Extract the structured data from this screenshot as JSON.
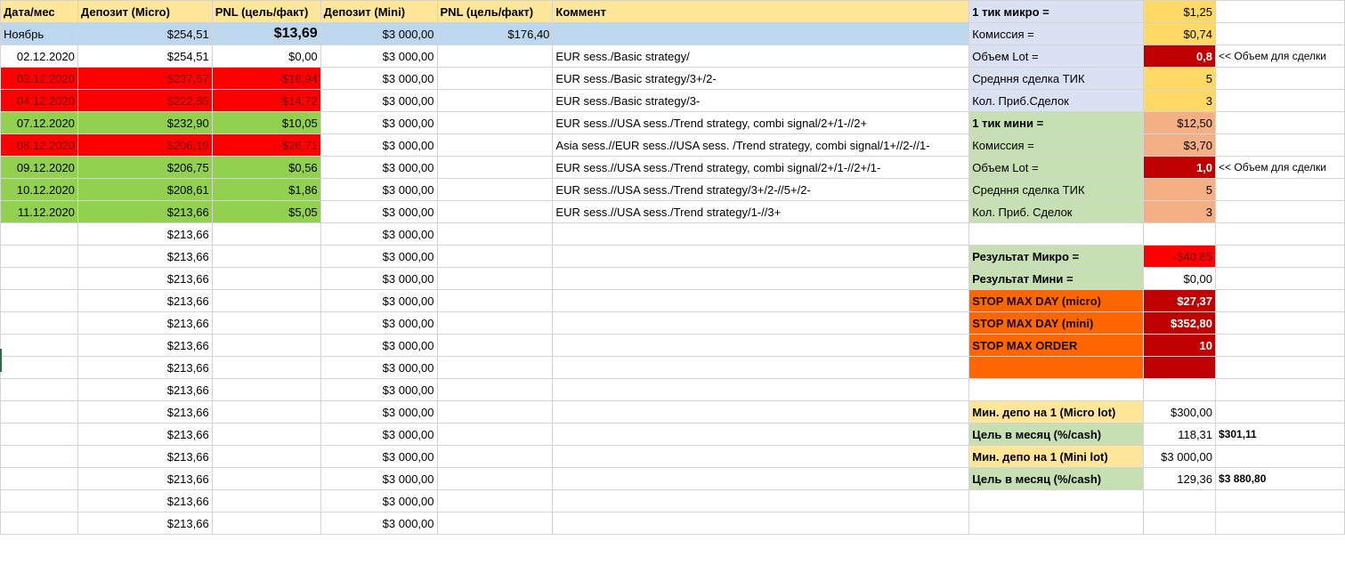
{
  "headers": [
    "Дата/мес",
    "Депозит (Micro)",
    "PNL (цель/факт)",
    "Депозит (Mini)",
    "PNL (цель/факт)",
    "Коммент"
  ],
  "november": {
    "label": "Ноябрь",
    "deposit_micro": "$254,51",
    "pnl_micro": "$13,69",
    "deposit_mini": "$3 000,00",
    "pnl_mini": "$176,40"
  },
  "days": [
    {
      "date": "02.12.2020",
      "deposit_micro": "$254,51",
      "pnl": "$0,00",
      "deposit_mini": "$3 000,00",
      "comment": "EUR sess./Basic strategy/"
    },
    {
      "date": "03.12.2020",
      "deposit_micro": "$237,57",
      "pnl": "-$16,94",
      "deposit_mini": "$3 000,00",
      "comment": "EUR sess./Basic strategy/3+/2-"
    },
    {
      "date": "04.12.2020",
      "deposit_micro": "$222,85",
      "pnl": "-$14,72",
      "deposit_mini": "$3 000,00",
      "comment": "EUR sess./Basic strategy/3-"
    },
    {
      "date": "07.12.2020",
      "deposit_micro": "$232,90",
      "pnl": "$10,05",
      "deposit_mini": "$3 000,00",
      "comment": "EUR sess.//USA sess./Trend strategy, combi signal/2+/1-//2+"
    },
    {
      "date": "08.12.2020",
      "deposit_micro": "$206,19",
      "pnl": "-$26,71",
      "deposit_mini": "$3 000,00",
      "comment": "Asia sess.//EUR sess.//USA sess. /Trend strategy, combi signal/1+//2-//1-"
    },
    {
      "date": "09.12.2020",
      "deposit_micro": "$206,75",
      "pnl": "$0,56",
      "deposit_mini": "$3 000,00",
      "comment": "EUR sess.//USA sess./Trend strategy, combi signal/2+/1-//2+/1-"
    },
    {
      "date": "10.12.2020",
      "deposit_micro": "$208,61",
      "pnl": "$1,86",
      "deposit_mini": "$3 000,00",
      "comment": "EUR sess.//USA sess./Trend strategy/3+/2-//5+/2-"
    },
    {
      "date": "11.12.2020",
      "deposit_micro": "$213,66",
      "pnl": "$5,05",
      "deposit_mini": "$3 000,00",
      "comment": "EUR sess.//USA sess./Trend strategy/1-//3+"
    }
  ],
  "carry": {
    "deposit_micro": "$213,66",
    "deposit_mini": "$3 000,00"
  },
  "side": {
    "micro_tick_label": "1 тик микро =",
    "micro_tick": "$1,25",
    "micro_comm_label": "Комиссия =",
    "micro_comm": "$0,74",
    "micro_lot_label": "Объем  Lot =",
    "micro_lot": "0,8",
    "lot_note": "<< Объем для сделки",
    "micro_avg_label": "Средння сделка ТИК",
    "micro_avg": "5",
    "micro_cnt_label": "Кол. Приб.Сделок",
    "micro_cnt": "3",
    "mini_tick_label": "1 тик мини =",
    "mini_tick": "$12,50",
    "mini_comm_label": "Комиссия =",
    "mini_comm": "$3,70",
    "mini_lot_label": "Объем  Lot =",
    "mini_lot": "1,0",
    "mini_avg_label": "Средння сделка ТИК",
    "mini_avg": "5",
    "mini_cnt_label": "Кол. Приб. Сделок",
    "mini_cnt": "3",
    "res_micro_label": "Результат Микро =",
    "res_micro": "-$40,85",
    "res_mini_label": "Результат Мини =",
    "res_mini": "$0,00",
    "stop_micro_label": "STOP MAX DAY (micro)",
    "stop_micro": "$27,37",
    "stop_mini_label": "STOP MAX DAY (mini)",
    "stop_mini": "$352,80",
    "stop_order_label": "STOP MAX ORDER",
    "stop_order": "10",
    "min_micro_label": "Мин. депо на 1 (Micro lot)",
    "min_micro": "$300,00",
    "goal1_label": "Цель в месяц (%/cash)",
    "goal1_pct": "118,31",
    "goal1_cash": "$301,11",
    "min_mini_label": "Мин. депо на 1 (Mini lot)",
    "min_mini": "$3 000,00",
    "goal2_label": "Цель в месяц (%/cash)",
    "goal2_pct": "129,36",
    "goal2_cash": "$3 880,80"
  }
}
